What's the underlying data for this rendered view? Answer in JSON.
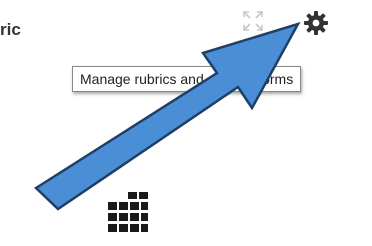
{
  "header": {
    "title_fragment": "ric",
    "expand_icon": "expand-icon",
    "settings_icon": "gear-icon"
  },
  "tooltip": {
    "text": "Manage rubrics and grading forms"
  },
  "annotation": {
    "arrow_color": "#4a8fd6",
    "arrow_outline": "#1f3f66"
  },
  "launcher": {
    "icon": "grid-icon",
    "color": "#1a1a1a"
  }
}
